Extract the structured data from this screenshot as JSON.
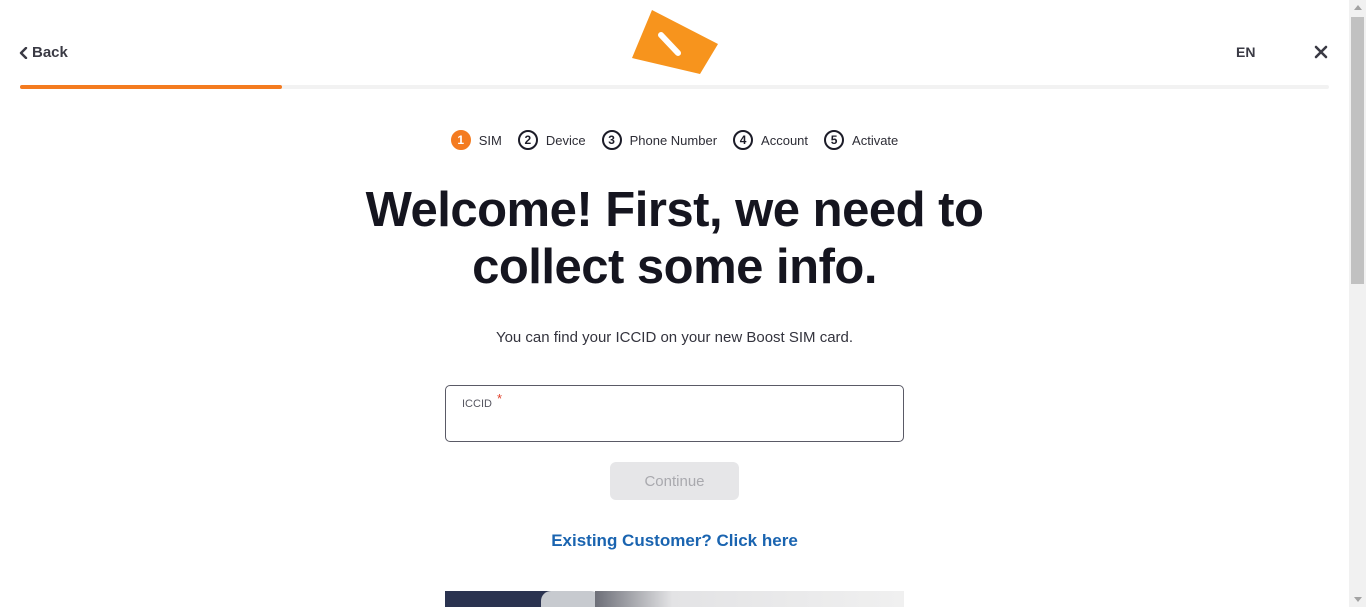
{
  "header": {
    "back_label": "Back",
    "language": "EN",
    "progress_fraction": 0.2
  },
  "steps": [
    {
      "num": "1",
      "label": "SIM",
      "active": true
    },
    {
      "num": "2",
      "label": "Device",
      "active": false
    },
    {
      "num": "3",
      "label": "Phone Number",
      "active": false
    },
    {
      "num": "4",
      "label": "Account",
      "active": false
    },
    {
      "num": "5",
      "label": "Activate",
      "active": false
    }
  ],
  "main": {
    "title_line1": "Welcome! First, we need to",
    "title_line2": "collect some info.",
    "subtitle": "You can find your ICCID on your new Boost SIM card.",
    "iccid_label": "ICCID",
    "required_marker": "*",
    "iccid_value": "",
    "continue_label": "Continue",
    "existing_customer_link": "Existing Customer? Click here"
  },
  "colors": {
    "accent": "#f47b20",
    "link": "#1a64b0",
    "heading": "#15151f"
  },
  "icons": {
    "back": "chevron-left-icon",
    "logo": "boost-logo",
    "close": "close-icon"
  }
}
